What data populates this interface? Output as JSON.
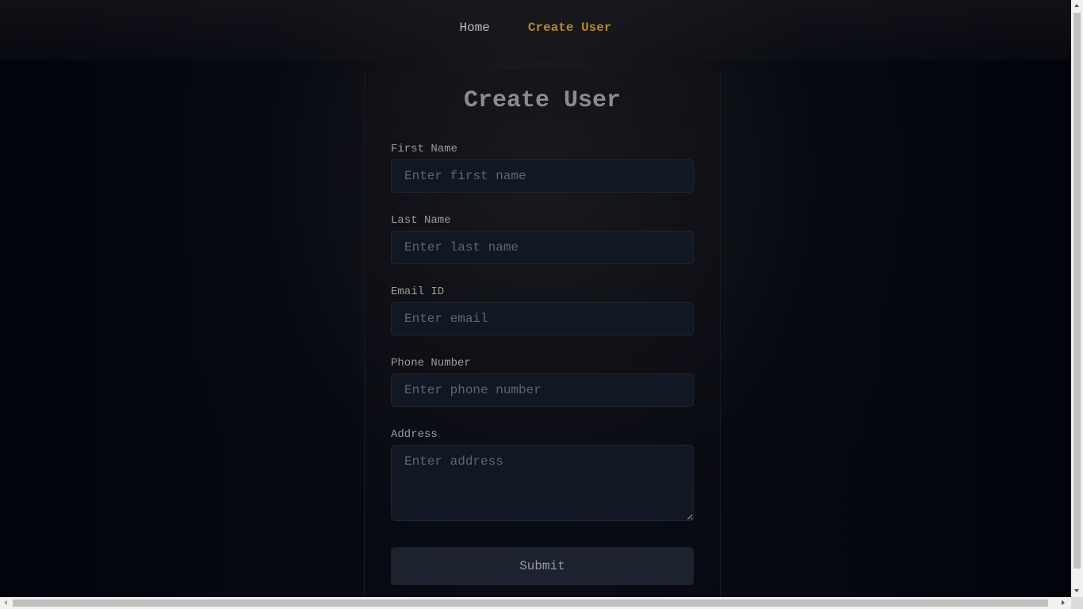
{
  "nav": {
    "items": [
      {
        "label": "Home",
        "active": false
      },
      {
        "label": "Create User",
        "active": true
      }
    ],
    "active_color": "#b8871c"
  },
  "form": {
    "title": "Create User",
    "fields": [
      {
        "label": "First Name",
        "placeholder": "Enter first name",
        "value": ""
      },
      {
        "label": "Last Name",
        "placeholder": "Enter last name",
        "value": ""
      },
      {
        "label": "Email ID",
        "placeholder": "Enter email",
        "value": ""
      },
      {
        "label": "Phone Number",
        "placeholder": "Enter phone number",
        "value": ""
      },
      {
        "label": "Address",
        "placeholder": "Enter address",
        "value": ""
      }
    ],
    "submit_label": "Submit"
  }
}
